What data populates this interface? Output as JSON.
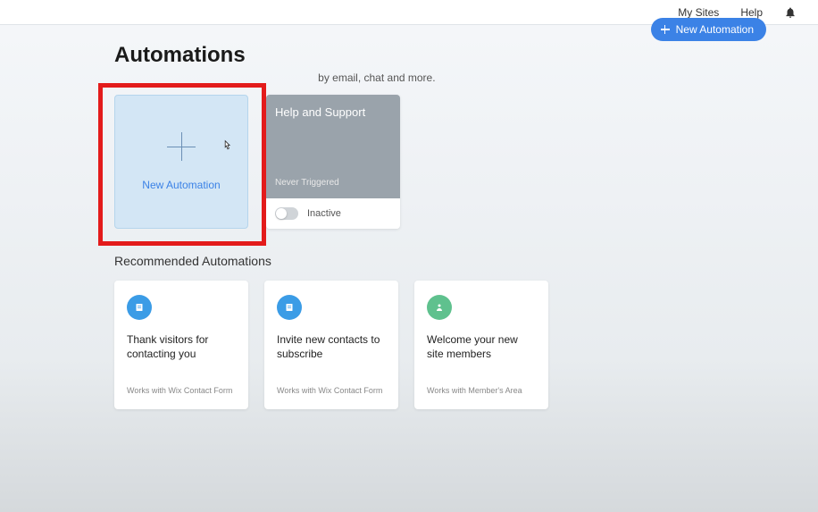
{
  "topbar": {
    "my_sites": "My Sites",
    "help": "Help"
  },
  "header": {
    "title": "Automations",
    "subtitle_partial": "by email, chat and more.",
    "new_button": "New Automation"
  },
  "new_card": {
    "label": "New Automation"
  },
  "help_card": {
    "title": "Help and Support",
    "trigger": "Never Triggered",
    "status": "Inactive"
  },
  "recommended": {
    "heading": "Recommended Automations",
    "cards": [
      {
        "title": "Thank visitors for contacting you",
        "sub": "Works with Wix Contact Form",
        "icon": "form",
        "color": "blue"
      },
      {
        "title": "Invite new contacts to subscribe",
        "sub": "Works with Wix Contact Form",
        "icon": "form",
        "color": "blue"
      },
      {
        "title": "Welcome your new site members",
        "sub": "Works with Member's Area",
        "icon": "person",
        "color": "green"
      }
    ]
  }
}
